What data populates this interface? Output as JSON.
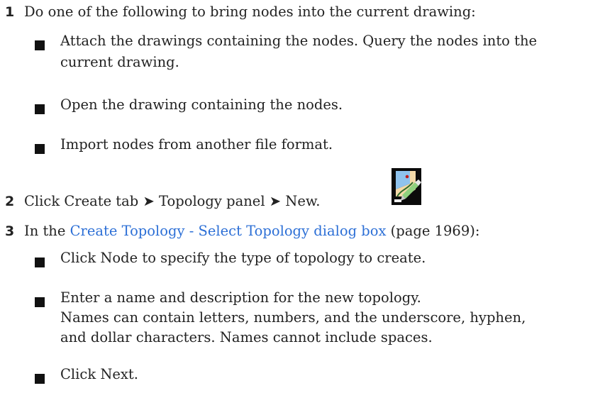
{
  "steps": [
    {
      "number": "1",
      "text": "Do one of the following to bring nodes into the current drawing:",
      "bullets": [
        {
          "line1": "Attach the drawings containing the nodes. Query the nodes into the",
          "line2": "current drawing."
        },
        {
          "line1": "Open the drawing containing the nodes."
        },
        {
          "line1": "Import nodes from another file format."
        }
      ]
    },
    {
      "number": "2",
      "text": "Click Create tab ➤ Topology panel ➤ New.",
      "icon": "new-topology-icon"
    },
    {
      "number": "3",
      "text_before": "In the ",
      "link": "Create Topology - Select Topology dialog box",
      "text_after": " (page 1969):",
      "bullets": [
        {
          "line1": "Click Node to specify the type of topology to create."
        },
        {
          "line1": "Enter a name and description for the new topology.",
          "line2": "Names can contain letters, numbers, and the underscore, hyphen,",
          "line3": "and dollar characters. Names cannot include spaces."
        },
        {
          "line1": "Click Next."
        }
      ]
    }
  ],
  "colors": {
    "link": "#2c6fd6",
    "text": "#222222"
  }
}
